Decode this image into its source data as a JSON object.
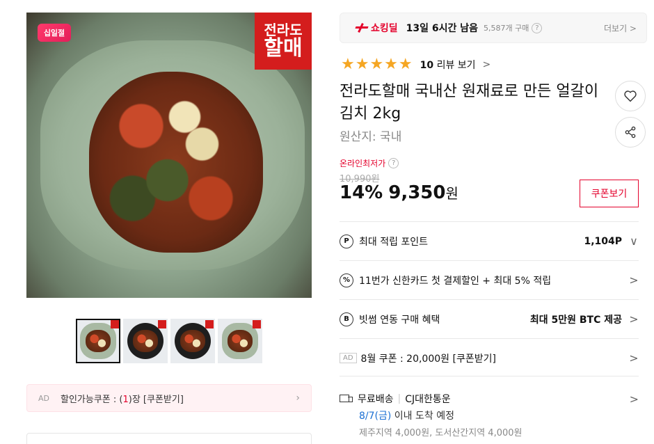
{
  "product_images": {
    "promo_badge": "십일절",
    "brand_logo_line1": "전라도",
    "brand_logo_line2": "할매",
    "thumbnails": [
      "thumb-1",
      "thumb-2",
      "thumb-3",
      "thumb-4"
    ],
    "selected_thumbnail": 1
  },
  "coupon_ad": {
    "ad_label": "AD",
    "text_prefix": "할인가능쿠폰 : (",
    "count": "1",
    "text_suffix": ")장 [쿠폰받기]"
  },
  "deal": {
    "label": "쇼킹딜",
    "time_left": "13일 6시간 남음",
    "purchase_count": "5,587개 구매",
    "help": "?",
    "more": "더보기 >"
  },
  "rating": {
    "stars": "★★★★★",
    "score": 4.5,
    "review_count": "10",
    "review_label": "리뷰 보기",
    "chevron": ">"
  },
  "product": {
    "title": "전라도할매 국내산 원재료로 만든 얼갈이김치 2kg",
    "origin": "원산지: 국내"
  },
  "price": {
    "lowest_label": "온라인최저가",
    "original": "10,990원",
    "discount": "14%",
    "sale": "9,350",
    "currency": "원",
    "coupon_button": "쿠폰보기"
  },
  "benefits": [
    {
      "icon": "P",
      "label": "최대 적립 포인트",
      "value": "1,104P",
      "chevron": "∨"
    },
    {
      "icon": "%",
      "label": "11번가 신한카드 첫 결제할인 + 최대 5% 적립",
      "value": "",
      "chevron": ">"
    },
    {
      "icon": "B",
      "label": "빗썸 연동 구매 혜택",
      "value": "최대 5만원 BTC 제공",
      "chevron": ">"
    },
    {
      "ad": "AD",
      "label": "8월 쿠폰 : 20,000원 [쿠폰받기]",
      "value": "",
      "chevron": ">"
    }
  ],
  "shipping": {
    "type": "무료배송",
    "carrier": "CJ대한통운",
    "date": "8/7(금)",
    "eta_suffix": " 이내 도착 예정",
    "extra": "제주지역 4,000원, 도서산간지역 4,000원",
    "chevron": ">"
  },
  "colors": {
    "accent": "#e4002b",
    "star": "#f5a623",
    "link_blue": "#1a6fd3"
  }
}
